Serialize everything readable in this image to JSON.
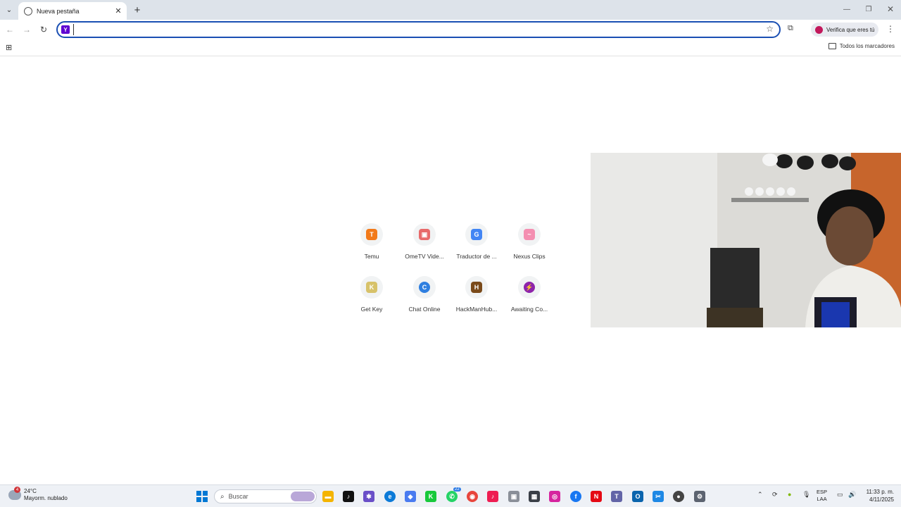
{
  "browser": {
    "tab_title": "Nueva pestaña",
    "profile_chip": "Verifica que eres tú",
    "omnibox_value": "",
    "all_bookmarks": "Todos los marcadores"
  },
  "shortcuts": [
    {
      "label": "Temu",
      "icon": "temu-icon",
      "color": "#f27a1a"
    },
    {
      "label": "OmeTV Vide...",
      "icon": "ometv-icon",
      "color": "#e86a6a"
    },
    {
      "label": "Traductor de ...",
      "icon": "google-translate-icon",
      "color": "#4285f4"
    },
    {
      "label": "Nexus Clips",
      "icon": "nexus-clips-icon",
      "color": "#f48fb1"
    },
    {
      "label": "Get Key",
      "icon": "get-key-icon",
      "color": "#d7c26a"
    },
    {
      "label": "Chat Online",
      "icon": "chat-online-icon",
      "color": "#2f7fe0"
    },
    {
      "label": "HackManHub...",
      "icon": "hackmanhub-icon",
      "color": "#7a4a1a"
    },
    {
      "label": "Awaiting Co...",
      "icon": "awaiting-icon",
      "color": "#8e24aa"
    }
  ],
  "taskbar": {
    "weather_temp": "24°C",
    "weather_desc": "Mayorm. nublado",
    "weather_badge": "4",
    "search_placeholder": "Buscar",
    "lang_top": "ESP",
    "lang_bottom": "LAA",
    "time": "11:33 p. m.",
    "date": "4/11/2025",
    "whatsapp_badge": "22"
  }
}
